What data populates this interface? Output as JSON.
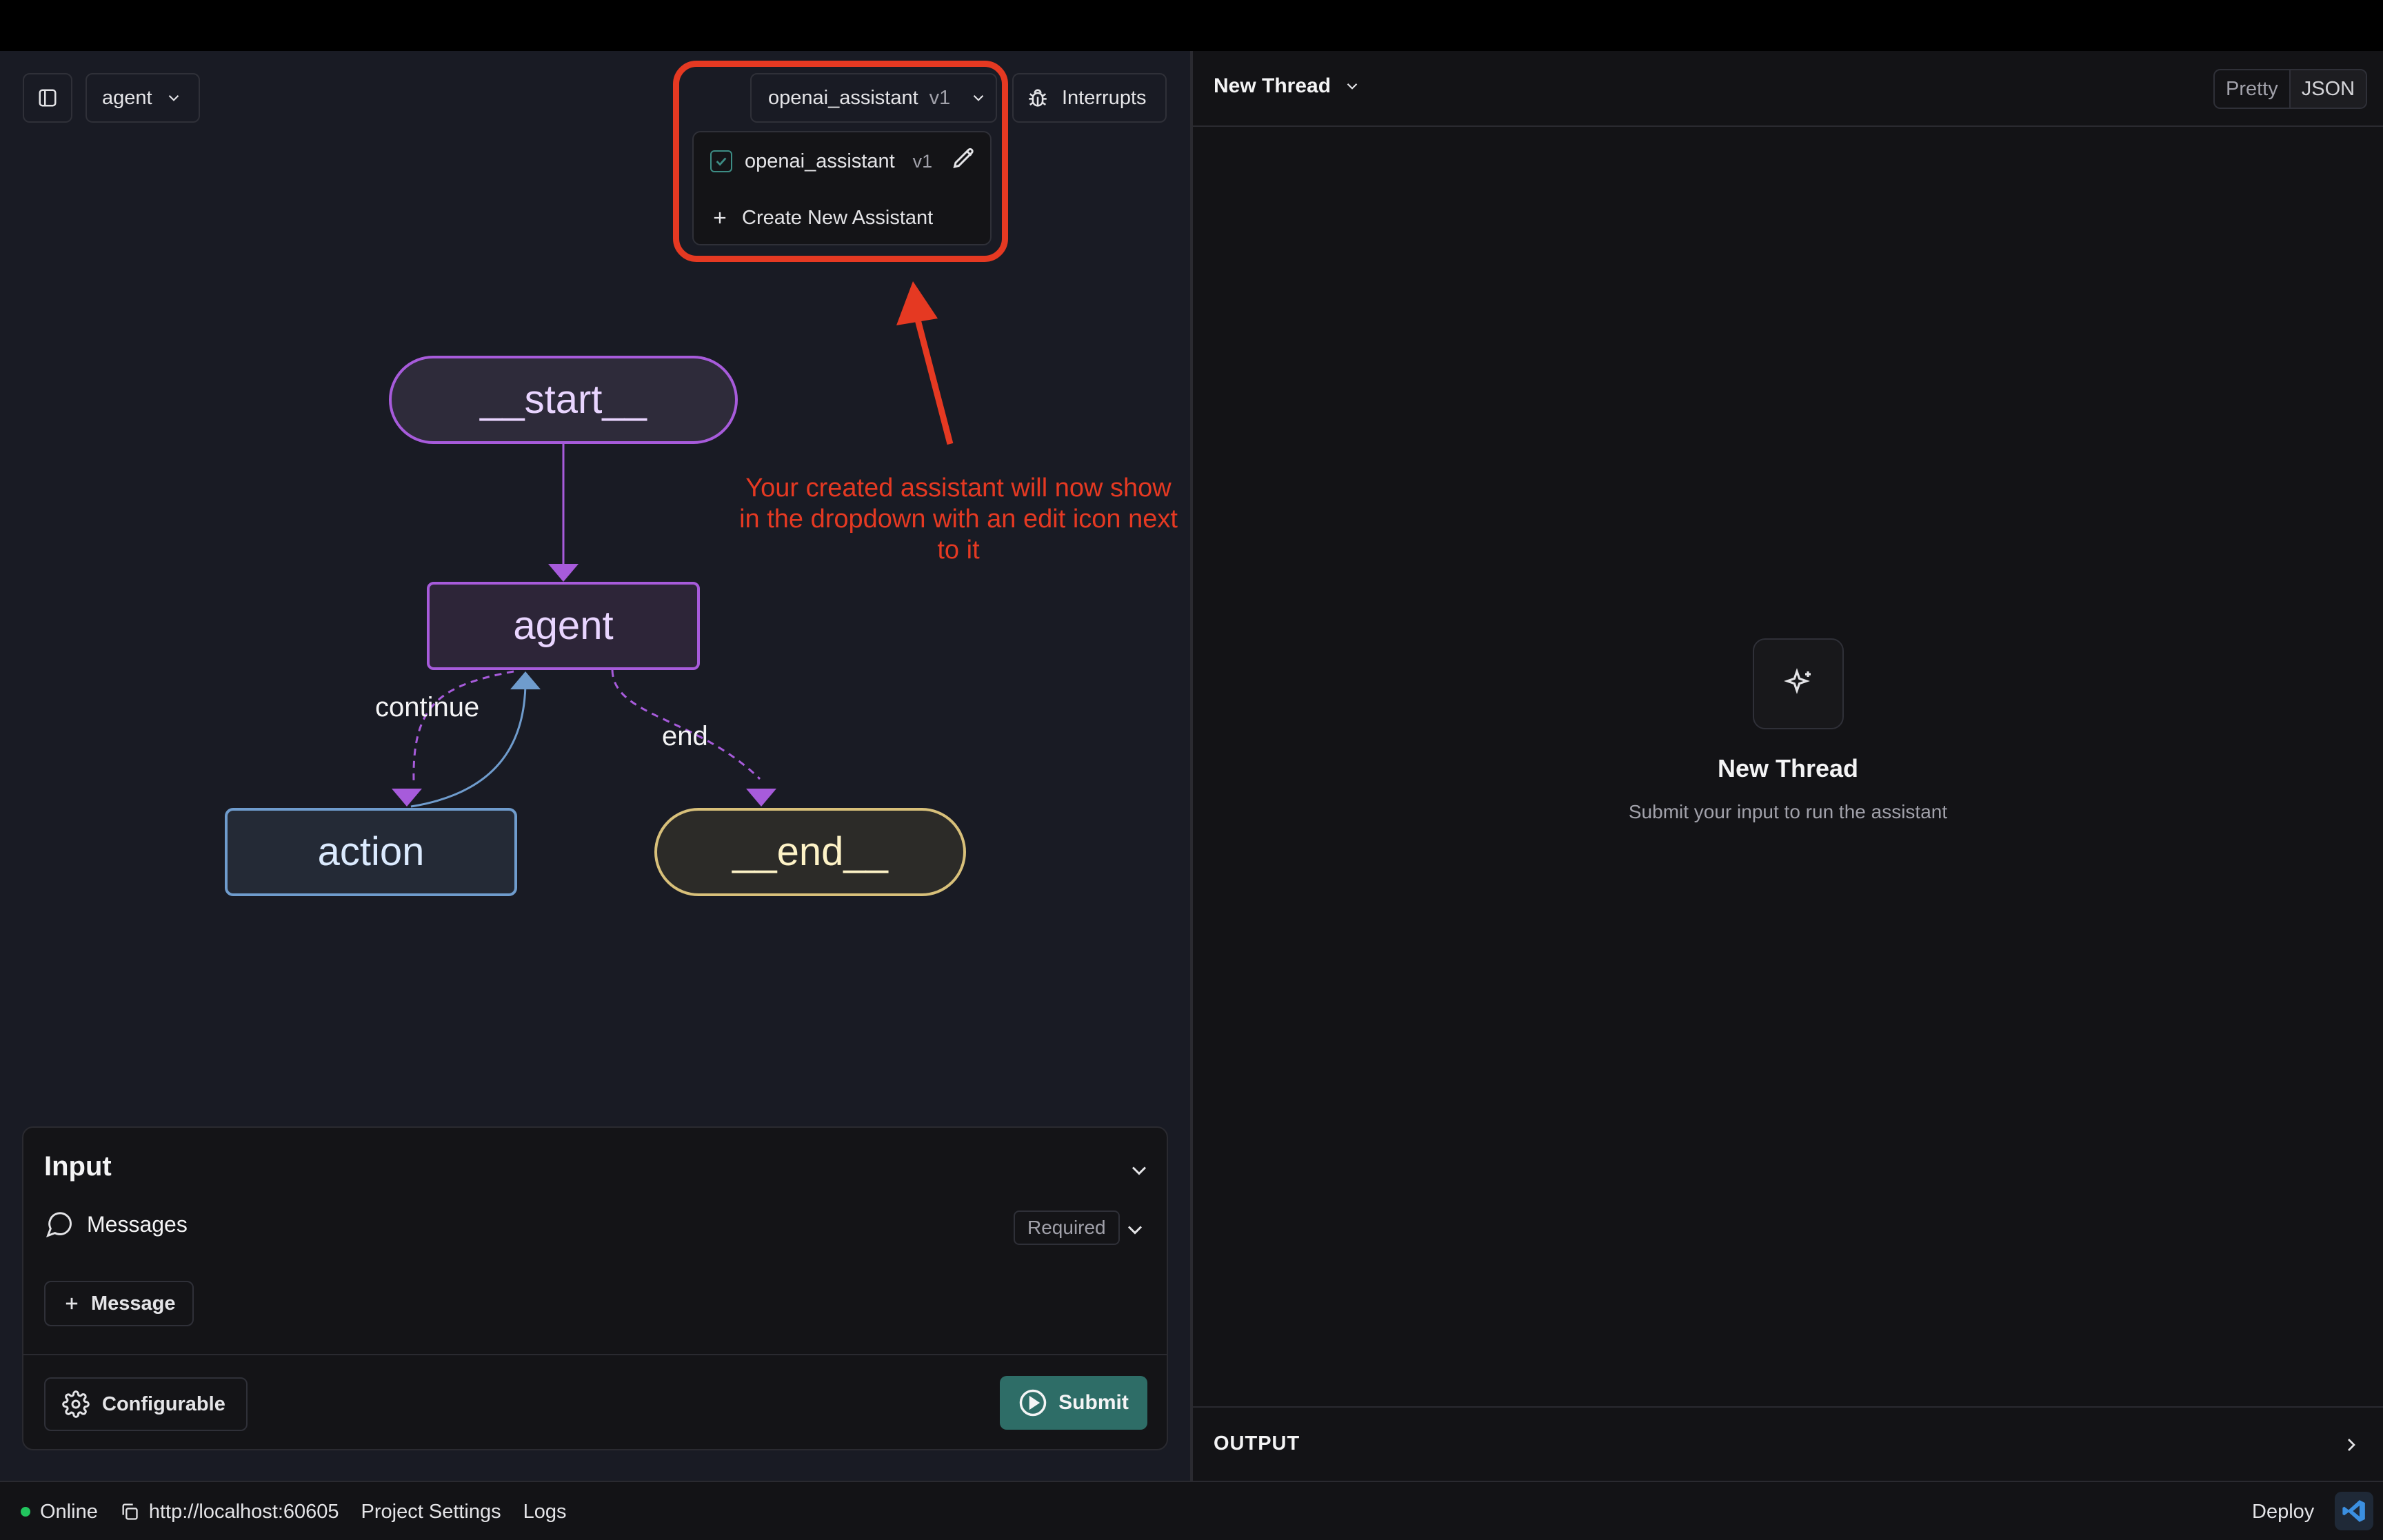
{
  "header": {
    "graph_selector": "agent",
    "assistant_selector": {
      "name": "openai_assistant",
      "version": "v1"
    },
    "interrupts_label": "Interrupts"
  },
  "assistant_dropdown": {
    "items": [
      {
        "name": "openai_assistant",
        "version": "v1",
        "checked": true
      },
      {
        "name": "Create New Assistant"
      }
    ]
  },
  "annotation": {
    "text": "Your created assistant will now show in the dropdown with an edit icon next to it",
    "color": "#e53922"
  },
  "graph": {
    "nodes": {
      "start": "__start__",
      "agent": "agent",
      "action": "action",
      "end": "__end__"
    },
    "edges": {
      "continue": "continue",
      "end": "end"
    },
    "colors": {
      "agent": "#a75bdb",
      "action": "#6f9ccd",
      "end": "#d8c07a"
    }
  },
  "input_panel": {
    "title": "Input",
    "field_label": "Messages",
    "required_label": "Required",
    "add_message_label": "Message",
    "configurable_label": "Configurable",
    "submit_label": "Submit",
    "accent": "#2e6d67"
  },
  "thread": {
    "title": "New Thread",
    "view_modes": [
      "Pretty",
      "JSON"
    ],
    "empty_title": "New Thread",
    "empty_subtitle": "Submit your input to run the assistant",
    "output_label": "OUTPUT"
  },
  "statusbar": {
    "status": "Online",
    "url": "http://localhost:60605",
    "project_settings": "Project Settings",
    "logs": "Logs",
    "deploy": "Deploy"
  },
  "icons": [
    "sidebar-toggle-icon",
    "chevron-down-icon",
    "bug-icon",
    "checkbox-icon",
    "pencil-icon",
    "plus-icon",
    "chat-bubble-icon",
    "gear-icon",
    "play-circle-icon",
    "sparkle-icon",
    "chevron-right-icon",
    "copy-icon",
    "vscode-icon"
  ]
}
